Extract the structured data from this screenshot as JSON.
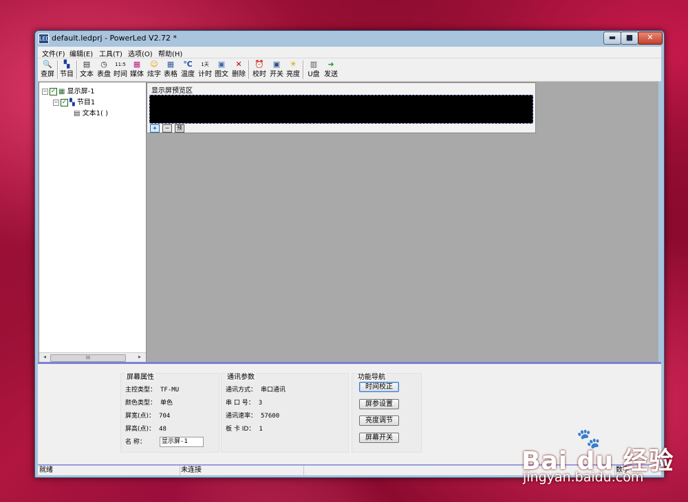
{
  "window": {
    "title": "default.ledprj - PowerLed V2.72 *",
    "app_icon_text": "LED",
    "caption_buttons": {
      "minimize": "▬",
      "maximize": "■",
      "close": "✕"
    }
  },
  "menu": [
    "文件(F)",
    "编辑(E)",
    "工具(T)",
    "选项(O)",
    "帮助(H)"
  ],
  "toolbar": [
    {
      "label": "查屏",
      "icon": "magnifier-icon",
      "glyph": "🔍"
    },
    {
      "label": "节目",
      "icon": "program-icon",
      "glyph": "▚"
    },
    {
      "label": "文本",
      "icon": "text-icon",
      "glyph": "▤"
    },
    {
      "label": "表盘",
      "icon": "clock-icon",
      "glyph": "◷"
    },
    {
      "label": "时间",
      "icon": "digital-time-icon",
      "glyph": "11:5"
    },
    {
      "label": "媒体",
      "icon": "media-icon",
      "glyph": "▦"
    },
    {
      "label": "炫字",
      "icon": "smiley-icon",
      "glyph": "☺"
    },
    {
      "label": "表格",
      "icon": "table-icon",
      "glyph": "▦"
    },
    {
      "label": "温度",
      "icon": "temperature-icon",
      "glyph": "℃"
    },
    {
      "label": "计时",
      "icon": "timer-icon",
      "glyph": "1天"
    },
    {
      "label": "图文",
      "icon": "image-text-icon",
      "glyph": "▣"
    },
    {
      "label": "删除",
      "icon": "delete-icon",
      "glyph": "✕"
    },
    {
      "label": "校时",
      "icon": "sync-time-icon",
      "glyph": "⏰"
    },
    {
      "label": "开关",
      "icon": "power-switch-icon",
      "glyph": "▣"
    },
    {
      "label": "亮度",
      "icon": "brightness-icon",
      "glyph": "☀"
    },
    {
      "label": "U盘",
      "icon": "usb-disk-icon",
      "glyph": "▥"
    },
    {
      "label": "发送",
      "icon": "send-icon",
      "glyph": "➜"
    }
  ],
  "tree": {
    "screen": "显示屏-1",
    "program": "节目1",
    "text": "文本1(            )",
    "scroll_thumb": "III"
  },
  "preview": {
    "title": "显示屏预览区",
    "zoom_in": "+",
    "zoom_out": "−",
    "preview_btn": "预"
  },
  "screen_props": {
    "title": "屏幕属性",
    "rows": [
      {
        "label": "主控类型：",
        "value": "TF-MU"
      },
      {
        "label": "颜色类型：",
        "value": "单色"
      },
      {
        "label": "屏宽(点)：",
        "value": "704"
      },
      {
        "label": "屏高(点)：",
        "value": "48"
      }
    ],
    "name_label": "名    称：",
    "name_value": "显示屏-1"
  },
  "comm_params": {
    "title": "通讯参数",
    "rows": [
      {
        "label": "通讯方式：",
        "value": "串口通讯"
      },
      {
        "label": "串 口 号：",
        "value": "3"
      },
      {
        "label": "通讯速率：",
        "value": "57600"
      },
      {
        "label": "板 卡 ID：",
        "value": "1"
      }
    ]
  },
  "nav": {
    "title": "功能导航",
    "buttons": [
      "时间校正",
      "屏参设置",
      "亮度调节",
      "屏幕开关"
    ]
  },
  "status": {
    "left": "就绪",
    "connection": "未连接",
    "right": "数字"
  },
  "watermark": {
    "brand": "Bai du 经验",
    "url": "jingyan.baidu.com",
    "paw": "🐾"
  }
}
